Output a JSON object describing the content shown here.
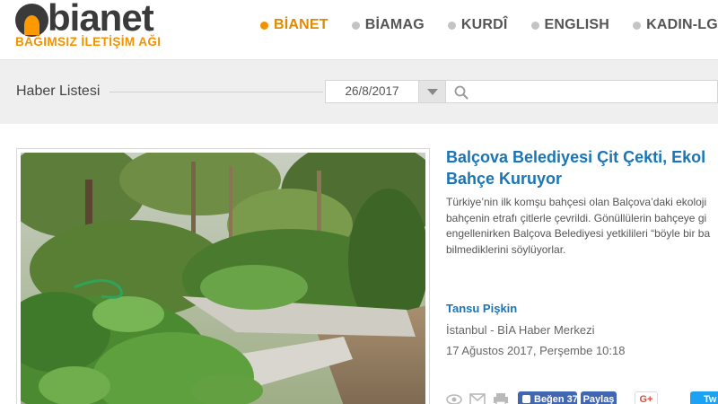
{
  "header": {
    "logo_word": "bianet",
    "logo_tagline": "BAĞIMSIZ İLETİŞİM AĞI",
    "nav": [
      {
        "label": "BİANET",
        "active": true
      },
      {
        "label": "BİAMAG",
        "active": false
      },
      {
        "label": "KURDÎ",
        "active": false
      },
      {
        "label": "ENGLISH",
        "active": false
      },
      {
        "label": "KADIN-LGBTİ",
        "active": false
      }
    ]
  },
  "list_bar": {
    "title": "Haber Listesi",
    "date_value": "26/8/2017",
    "search_value": ""
  },
  "article": {
    "headline_lines": [
      "Balçova Belediyesi Çit Çekti, Ekol",
      "Bahçe Kuruyor"
    ],
    "summary_lines": [
      "Türkiye’nin ilk komşu bahçesi olan Balçova’daki ekoloji",
      "bahçenin etrafı çitlerle çevrildi. Gönüllülerin bahçeye gi",
      "engellenirken Balçova Belediyesi yetkilileri “böyle bir ba",
      "bilmediklerini söylüyorlar."
    ],
    "author": "Tansu Pişkin",
    "location": "İstanbul - BİA Haber Merkezi",
    "date": "17 Ağustos 2017, Perşembe 10:18"
  },
  "share": {
    "like_label": "Beğen 37",
    "share_label": "Paylaş",
    "gplus_label": "G+",
    "tweet_label": "Tw"
  },
  "colors": {
    "accent_orange": "#f39200",
    "link_blue": "#1a75b6",
    "facebook_blue": "#4267b2",
    "twitter_blue": "#1da1f2"
  }
}
